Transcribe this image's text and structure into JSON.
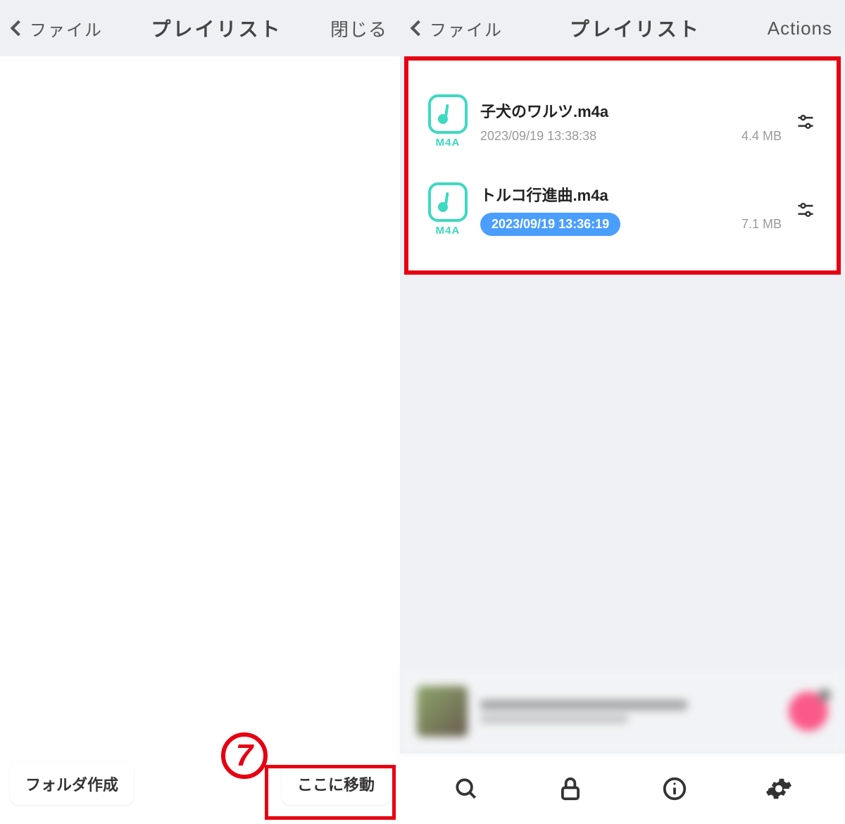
{
  "left": {
    "back_label": "ファイル",
    "title": "プレイリスト",
    "close_label": "閉じる",
    "folder_create_label": "フォルダ作成",
    "move_here_label": "ここに移動",
    "step_number": "7"
  },
  "right": {
    "back_label": "ファイル",
    "title": "プレイリスト",
    "actions_label": "Actions",
    "files": [
      {
        "name": "子犬のワルツ.m4a",
        "date": "2023/09/19 13:38:38",
        "size": "4.4 MB",
        "ext": "M4A",
        "highlighted": false
      },
      {
        "name": "トルコ行進曲.m4a",
        "date": "2023/09/19 13:36:19",
        "size": "7.1 MB",
        "ext": "M4A",
        "highlighted": true
      }
    ],
    "tabs": [
      "search",
      "lock",
      "info",
      "settings"
    ]
  }
}
